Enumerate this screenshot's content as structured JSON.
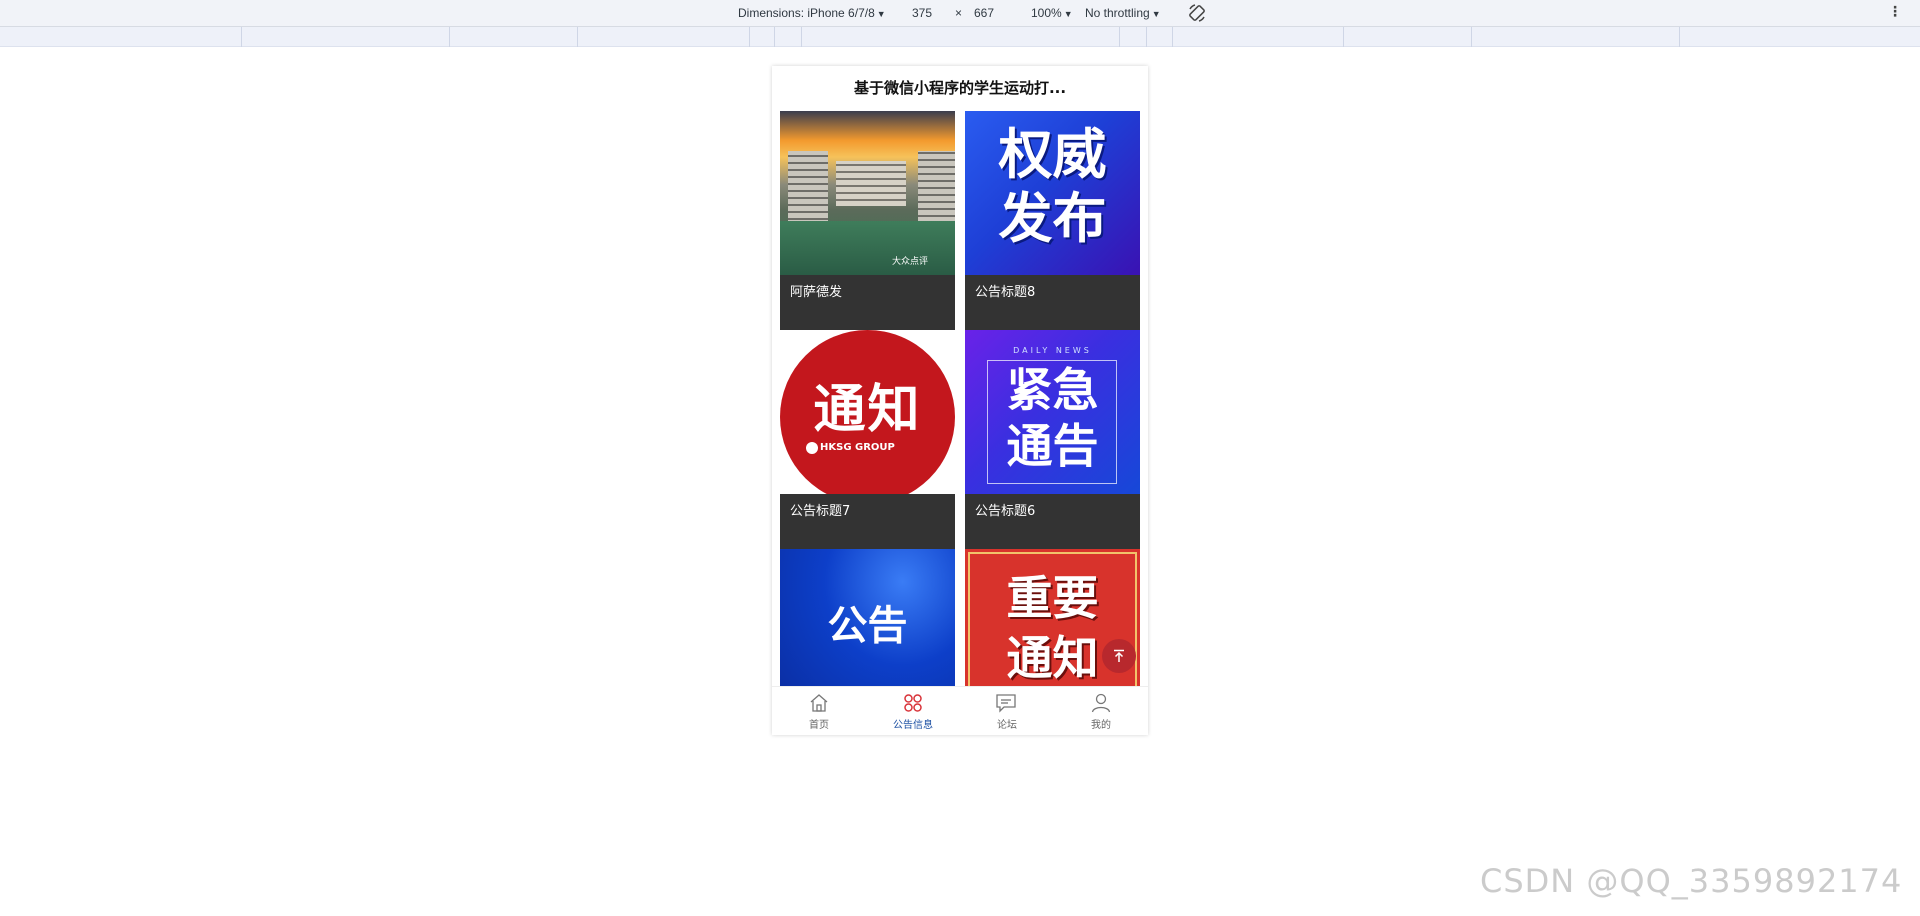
{
  "devtools": {
    "dimensions_label": "Dimensions: iPhone 6/7/8",
    "width": "375",
    "times": "×",
    "height": "667",
    "zoom": "100%",
    "throttling": "No throttling"
  },
  "page": {
    "title": "基于微信小程序的学生运动打..."
  },
  "cards": [
    {
      "caption": "阿萨德发",
      "thumb_lines": [],
      "thumb_overlay": "大众点评",
      "colors": [
        "#f7a13a",
        "#2f6e4f"
      ]
    },
    {
      "caption": "公告标题8",
      "thumb_lines": [
        "权威",
        "发布"
      ],
      "colors": [
        "#1d3fd8",
        "#2a1bbb"
      ]
    },
    {
      "caption": "公告标题7",
      "thumb_lines": [
        "通知"
      ],
      "thumb_overlay": "HKSG GROUP",
      "colors": [
        "#c3171d",
        "#ffffff"
      ]
    },
    {
      "caption": "公告标题6",
      "thumb_lines": [
        "紧急",
        "通告"
      ],
      "thumb_overlay": "DAILY NEWS",
      "colors": [
        "#5a1fe0",
        "#1c46d8"
      ]
    },
    {
      "caption": "",
      "thumb_lines": [
        "公告"
      ],
      "colors": [
        "#0d3fc9",
        "#0b2fa8"
      ]
    },
    {
      "caption": "",
      "thumb_lines": [
        "重要",
        "通知"
      ],
      "colors": [
        "#d8332c",
        "#c42a24"
      ]
    }
  ],
  "tabbar": [
    {
      "label": "首页",
      "icon": "home-icon"
    },
    {
      "label": "公告信息",
      "icon": "grid-icon",
      "active": true
    },
    {
      "label": "论坛",
      "icon": "chat-icon"
    },
    {
      "label": "我的",
      "icon": "user-icon"
    }
  ],
  "colors": {
    "active_tab_icon": "#d9343a",
    "active_tab_label": "#1b4fa3",
    "back_top": "#b8282d"
  },
  "watermark": "CSDN @QQ_3359892174"
}
